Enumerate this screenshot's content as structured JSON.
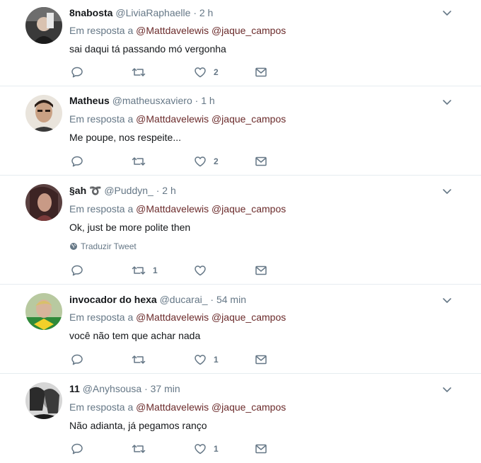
{
  "reply_prefix": "Em resposta a",
  "mention_1": "@Mattdavelewis",
  "mention_2": "@jaque_campos",
  "translate_label": "Traduzir Tweet",
  "colors": {
    "text": "#14171a",
    "muted": "#657786",
    "mention": "#6b2b2b",
    "divider": "#e6ecf0"
  },
  "tweets": [
    {
      "name": "8nabosta",
      "handle": "@LiviaRaphaelle",
      "time": "2 h",
      "text": "sai daqui tá passando mó vergonha",
      "replies": "",
      "retweets": "",
      "likes": "2"
    },
    {
      "name": "Matheus",
      "handle": "@matheusxaviero",
      "time": "1 h",
      "text": "Me poupe, nos respeite...",
      "replies": "",
      "retweets": "",
      "likes": "2"
    },
    {
      "name": "§ah ➰",
      "handle": "@Puddyn_",
      "time": "2 h",
      "text": "Ok, just be more polite then",
      "replies": "",
      "retweets": "1",
      "likes": ""
    },
    {
      "name": "invocador do hexa",
      "handle": "@ducarai_",
      "time": "54 min",
      "text": "você não tem que achar nada",
      "replies": "",
      "retweets": "",
      "likes": "1"
    },
    {
      "name": "11",
      "handle": "@Anyhsousa",
      "time": "37 min",
      "text": "Não adianta, já pegamos ranço",
      "replies": "",
      "retweets": "",
      "likes": "1"
    }
  ]
}
